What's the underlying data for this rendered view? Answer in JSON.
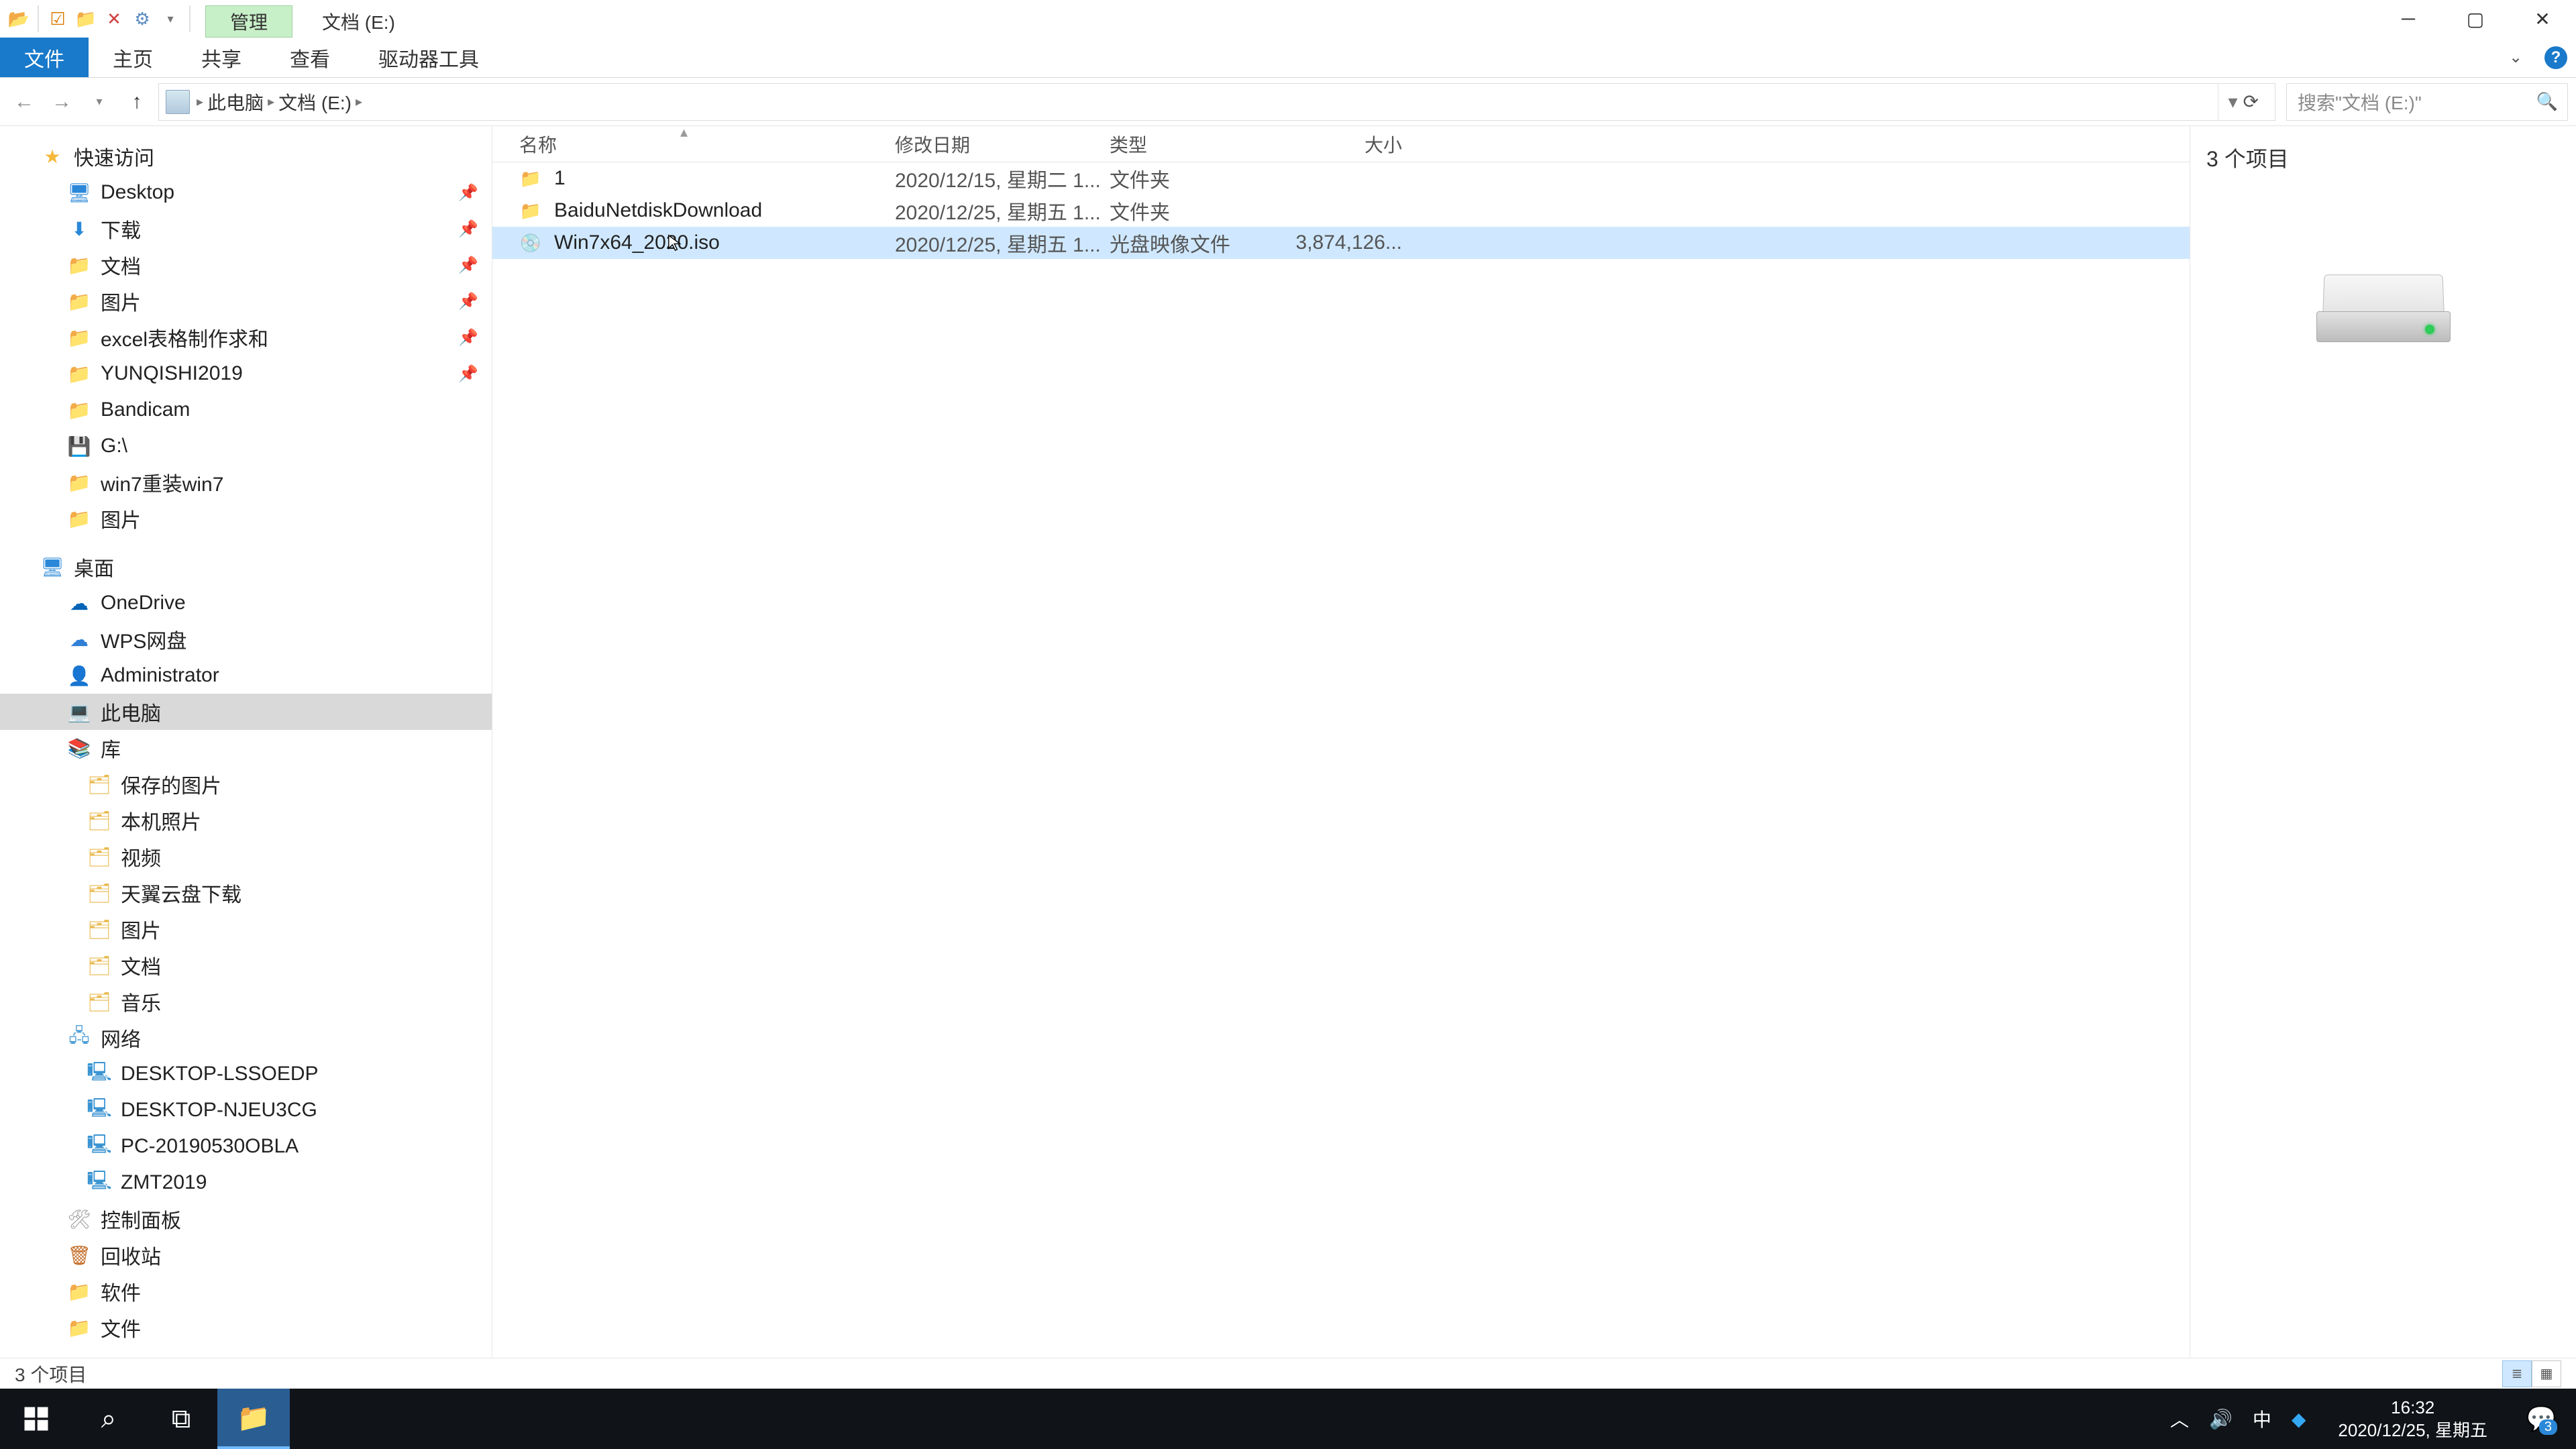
{
  "titlebar": {
    "context_tab": "管理",
    "window_title": "文档 (E:)"
  },
  "ribbon": {
    "file": "文件",
    "home": "主页",
    "share": "共享",
    "view": "查看",
    "drive_tools": "驱动器工具"
  },
  "breadcrumbs": {
    "root": "此电脑",
    "leaf": "文档 (E:)"
  },
  "search": {
    "placeholder": "搜索\"文档 (E:)\""
  },
  "sidebar": {
    "quick": "快速访问",
    "quick_items": [
      {
        "label": "Desktop",
        "pin": true
      },
      {
        "label": "下载",
        "pin": true
      },
      {
        "label": "文档",
        "pin": true
      },
      {
        "label": "图片",
        "pin": true
      },
      {
        "label": "excel表格制作求和",
        "pin": true
      },
      {
        "label": "YUNQISHI2019",
        "pin": true
      },
      {
        "label": "Bandicam",
        "pin": false
      },
      {
        "label": "G:\\",
        "pin": false
      },
      {
        "label": "win7重装win7",
        "pin": false
      },
      {
        "label": "图片",
        "pin": false
      }
    ],
    "desktop": "桌面",
    "onedrive": "OneDrive",
    "wps": "WPS网盘",
    "admin": "Administrator",
    "thispc": "此电脑",
    "libraries": "库",
    "lib_items": [
      "保存的图片",
      "本机照片",
      "视频",
      "天翼云盘下载",
      "图片",
      "文档",
      "音乐"
    ],
    "network": "网络",
    "net_items": [
      "DESKTOP-LSSOEDP",
      "DESKTOP-NJEU3CG",
      "PC-20190530OBLA",
      "ZMT2019"
    ],
    "control": "控制面板",
    "recycle": "回收站",
    "software": "软件",
    "files": "文件"
  },
  "columns": {
    "name": "名称",
    "date": "修改日期",
    "type": "类型",
    "size": "大小"
  },
  "rows": [
    {
      "name": "1",
      "date": "2020/12/15, 星期二 1...",
      "type": "文件夹",
      "size": "",
      "icon": "folder",
      "selected": false
    },
    {
      "name": "BaiduNetdiskDownload",
      "date": "2020/12/25, 星期五 1...",
      "type": "文件夹",
      "size": "",
      "icon": "folder",
      "selected": false
    },
    {
      "name": "Win7x64_2020.iso",
      "date": "2020/12/25, 星期五 1...",
      "type": "光盘映像文件",
      "size": "3,874,126...",
      "icon": "iso",
      "selected": true
    }
  ],
  "preview": {
    "count": "3 个项目"
  },
  "status": {
    "text": "3 个项目"
  },
  "taskbar": {
    "time": "16:32",
    "date": "2020/12/25, 星期五",
    "ime": "中",
    "action_count": "3"
  }
}
